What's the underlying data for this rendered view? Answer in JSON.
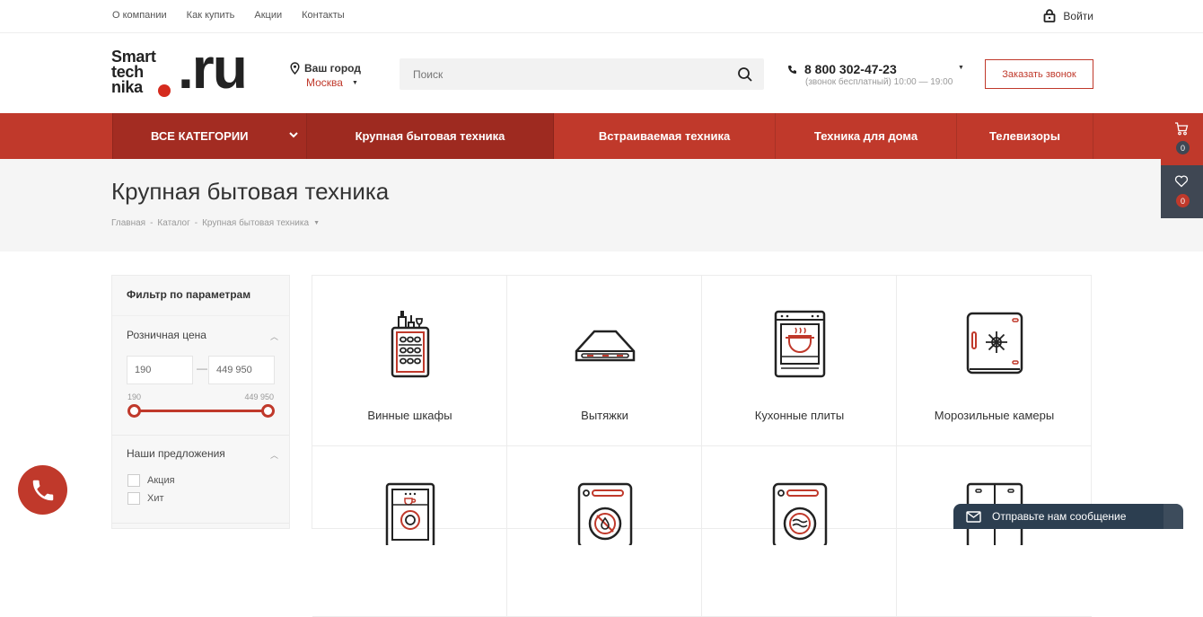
{
  "topnav": {
    "links": [
      "О компании",
      "Как купить",
      "Акции",
      "Контакты"
    ],
    "login_label": "Войти"
  },
  "logo": {
    "line1": "Smart",
    "line2": "tech",
    "line3": "nika",
    "big": ".ru"
  },
  "city": {
    "title": "Ваш город",
    "value": "Москва"
  },
  "search": {
    "placeholder": "Поиск"
  },
  "phone": {
    "number": "8 800 302-47-23",
    "hours": "(звонок бесплатный) 10:00 — 19:00"
  },
  "callback_label": "Заказать звонок",
  "menu": {
    "all_label": "ВСЕ КАТЕГОРИИ",
    "items": [
      "Крупная бытовая техника",
      "Встраиваемая техника",
      "Техника для дома",
      "Телевизоры"
    ]
  },
  "page": {
    "title": "Крупная бытовая техника",
    "breadcrumb": [
      "Главная",
      "Каталог",
      "Крупная бытовая техника"
    ]
  },
  "side": {
    "cart_count": "0",
    "fav_count": "0"
  },
  "filter": {
    "title": "Фильтр по параметрам",
    "price_title": "Розничная цена",
    "price_from": "190",
    "price_to": "449 950",
    "range_min": "190",
    "range_max": "449 950",
    "offers_title": "Наши предложения",
    "offers": [
      "Акция",
      "Хит"
    ]
  },
  "categories": [
    {
      "label": "Винные шкафы",
      "icon": "wine-cabinet-icon"
    },
    {
      "label": "Вытяжки",
      "icon": "hood-icon"
    },
    {
      "label": "Кухонные плиты",
      "icon": "stove-icon"
    },
    {
      "label": "Морозильные камеры",
      "icon": "freezer-icon"
    },
    {
      "label": "",
      "icon": "dishwasher-icon"
    },
    {
      "label": "",
      "icon": "dryer-icon"
    },
    {
      "label": "",
      "icon": "washer-icon"
    },
    {
      "label": "",
      "icon": "fridge-icon"
    }
  ],
  "chat": {
    "label": "Отправьте нам сообщение"
  },
  "colors": {
    "accent": "#c0392b",
    "dark": "#3f4753",
    "chat": "#2c3e50"
  }
}
